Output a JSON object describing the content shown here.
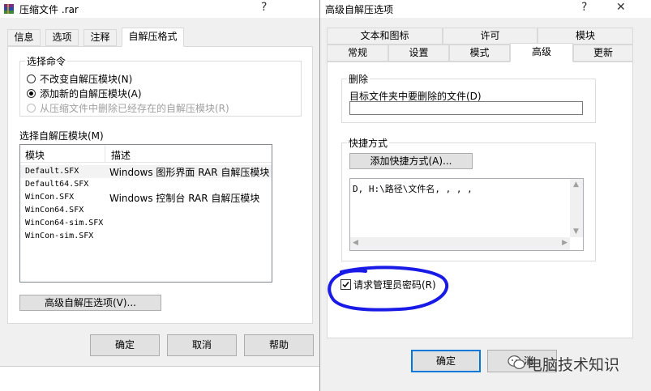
{
  "left_dialog": {
    "title": "压缩文件 .rar",
    "help_glyph": "?",
    "tabs": [
      "信息",
      "选项",
      "注释",
      "自解压格式"
    ],
    "select_command_label": "选择命令",
    "options": [
      {
        "label": "不改变自解压模块(N)",
        "selected": false,
        "enabled": true
      },
      {
        "label": "添加新的自解压模块(A)",
        "selected": true,
        "enabled": true
      },
      {
        "label": "从压缩文件中删除已经存在的自解压模块(R)",
        "selected": false,
        "enabled": false
      }
    ],
    "module_list_label": "选择自解压模块(M)",
    "columns": [
      "模块",
      "描述"
    ],
    "modules": [
      {
        "name": "Default.SFX",
        "desc": "Windows 图形界面 RAR 自解压模块"
      },
      {
        "name": "Default64.SFX",
        "desc": ""
      },
      {
        "name": "WinCon.SFX",
        "desc": "Windows 控制台 RAR 自解压模块"
      },
      {
        "name": "WinCon64.SFX",
        "desc": ""
      },
      {
        "name": "WinCon64-sim.SFX",
        "desc": ""
      },
      {
        "name": "WinCon-sim.SFX",
        "desc": ""
      }
    ],
    "advanced_button": "高级自解压选项(V)...",
    "ok": "确定",
    "cancel": "取消",
    "help": "帮助"
  },
  "right_dialog": {
    "title": "高级自解压选项",
    "help_glyph": "?",
    "close_glyph": "✕",
    "tabs_row_back": [
      "文本和图标",
      "许可",
      "模块"
    ],
    "tabs_row_front": [
      "常规",
      "设置",
      "模式",
      "高级",
      "更新"
    ],
    "delete_group_label": "删除",
    "delete_target_label": "目标文件夹中要删除的文件(D)",
    "delete_input_value": "",
    "shortcut_group_label": "快捷方式",
    "add_shortcut_button": "添加快捷方式(A)...",
    "shortcut_text": "D, H:\\路径\\文件名, , , ,",
    "request_admin_label": "请求管理员密码(R)",
    "request_admin_checked": true,
    "ok": "确定",
    "cancel_partial": "消"
  },
  "watermark": {
    "text": "电脑技术知识"
  },
  "annotation": {
    "color": "#1a1ae6"
  }
}
